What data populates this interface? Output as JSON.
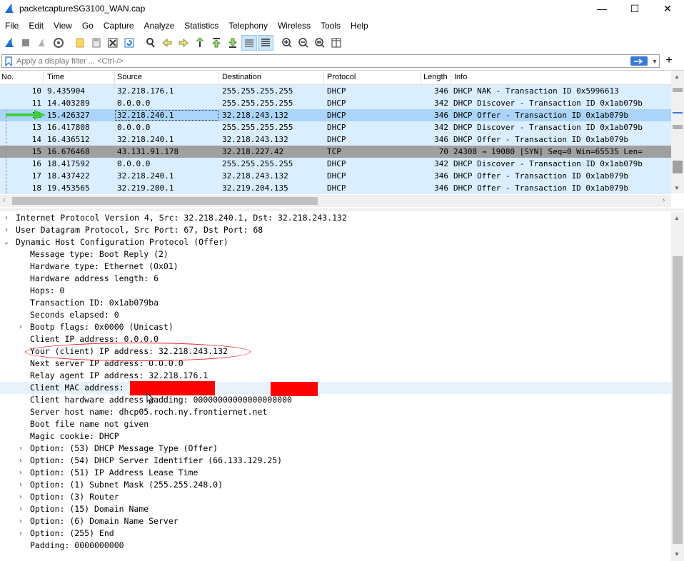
{
  "window": {
    "title": "packetcaptureSG3100_WAN.cap",
    "controls": {
      "minimize": "—",
      "maximize": "☐",
      "close": "✕"
    }
  },
  "menu": [
    "File",
    "Edit",
    "View",
    "Go",
    "Capture",
    "Analyze",
    "Statistics",
    "Telephony",
    "Wireless",
    "Tools",
    "Help"
  ],
  "filter": {
    "placeholder": "Apply a display filter ... <Ctrl-/>"
  },
  "packet_list": {
    "columns": [
      "No.",
      "Time",
      "Source",
      "Destination",
      "Protocol",
      "Length",
      "Info"
    ],
    "rows": [
      {
        "no": "10",
        "time": "9.435904",
        "src": "32.218.176.1",
        "dst": "255.255.255.255",
        "proto": "DHCP",
        "len": "346",
        "info": "DHCP NAK       - Transaction ID 0x5996613"
      },
      {
        "no": "11",
        "time": "14.403289",
        "src": "0.0.0.0",
        "dst": "255.255.255.255",
        "proto": "DHCP",
        "len": "342",
        "info": "DHCP Discover  - Transaction ID 0x1ab079b"
      },
      {
        "no": "12",
        "time": "15.426327",
        "src": "32.218.240.1",
        "dst": "32.218.243.132",
        "proto": "DHCP",
        "len": "346",
        "info": "DHCP Offer     - Transaction ID 0x1ab079b"
      },
      {
        "no": "13",
        "time": "16.417808",
        "src": "0.0.0.0",
        "dst": "255.255.255.255",
        "proto": "DHCP",
        "len": "342",
        "info": "DHCP Discover  - Transaction ID 0x1ab079b"
      },
      {
        "no": "14",
        "time": "16.436512",
        "src": "32.218.240.1",
        "dst": "32.218.243.132",
        "proto": "DHCP",
        "len": "346",
        "info": "DHCP Offer     - Transaction ID 0x1ab079b"
      },
      {
        "no": "15",
        "time": "16.676468",
        "src": "43.131.91.178",
        "dst": "32.218.227.42",
        "proto": "TCP",
        "len": "70",
        "info": "24308 → 19080 [SYN] Seq=0 Win=65535 Len="
      },
      {
        "no": "16",
        "time": "18.417592",
        "src": "0.0.0.0",
        "dst": "255.255.255.255",
        "proto": "DHCP",
        "len": "342",
        "info": "DHCP Discover  - Transaction ID 0x1ab079b"
      },
      {
        "no": "17",
        "time": "18.437422",
        "src": "32.218.240.1",
        "dst": "32.218.243.132",
        "proto": "DHCP",
        "len": "346",
        "info": "DHCP Offer     - Transaction ID 0x1ab079b"
      },
      {
        "no": "18",
        "time": "19.453565",
        "src": "32.219.200.1",
        "dst": "32.219.204.135",
        "proto": "DHCP",
        "len": "346",
        "info": "DHCP Offer     - Transaction ID 0x1ab079b"
      }
    ]
  },
  "details": [
    {
      "text": "Internet Protocol Version 4, Src: 32.218.240.1, Dst: 32.218.243.132",
      "exp": "›"
    },
    {
      "text": "User Datagram Protocol, Src Port: 67, Dst Port: 68",
      "exp": "›"
    },
    {
      "text": "Dynamic Host Configuration Protocol (Offer)",
      "exp": "⌄"
    },
    {
      "text": "Message type: Boot Reply (2)",
      "exp": ""
    },
    {
      "text": "Hardware type: Ethernet (0x01)",
      "exp": ""
    },
    {
      "text": "Hardware address length: 6",
      "exp": ""
    },
    {
      "text": "Hops: 0",
      "exp": ""
    },
    {
      "text": "Transaction ID: 0x1ab079ba",
      "exp": ""
    },
    {
      "text": "Seconds elapsed: 0",
      "exp": ""
    },
    {
      "text": "Bootp flags: 0x0000 (Unicast)",
      "exp": "›"
    },
    {
      "text": "Client IP address: 0.0.0.0",
      "exp": ""
    },
    {
      "text": "Your (client) IP address: 32.218.243.132",
      "exp": ""
    },
    {
      "text": "Next server IP address: 0.0.0.0",
      "exp": ""
    },
    {
      "text": "Relay agent IP address: 32.218.176.1",
      "exp": ""
    },
    {
      "text": "Client MAC address:                (00:08:a2:",
      "exp": ""
    },
    {
      "text": "Client hardware address padding: 00000000000000000000",
      "exp": ""
    },
    {
      "text": "Server host name: dhcp05.roch.ny.frontiernet.net",
      "exp": ""
    },
    {
      "text": "Boot file name not given",
      "exp": ""
    },
    {
      "text": "Magic cookie: DHCP",
      "exp": ""
    },
    {
      "text": "Option: (53) DHCP Message Type (Offer)",
      "exp": "›"
    },
    {
      "text": "Option: (54) DHCP Server Identifier (66.133.129.25)",
      "exp": "›"
    },
    {
      "text": "Option: (51) IP Address Lease Time",
      "exp": "›"
    },
    {
      "text": "Option: (1) Subnet Mask (255.255.248.0)",
      "exp": "›"
    },
    {
      "text": "Option: (3) Router",
      "exp": "›"
    },
    {
      "text": "Option: (15) Domain Name",
      "exp": "›"
    },
    {
      "text": "Option: (6) Domain Name Server",
      "exp": "›"
    },
    {
      "text": "Option: (255) End",
      "exp": "›"
    },
    {
      "text": "Padding: 0000000000",
      "exp": ""
    }
  ]
}
